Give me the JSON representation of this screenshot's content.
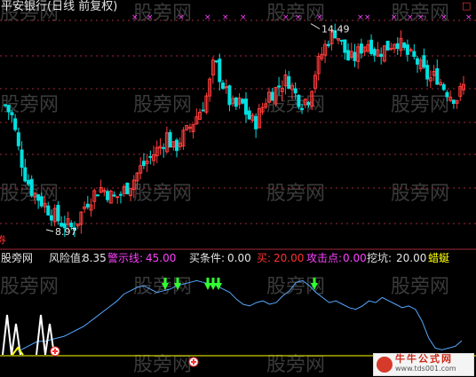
{
  "header": {
    "title": "平安银行(日线 前复权)",
    "corner_marker": "□"
  },
  "watermark": "股旁网",
  "watermark_footer": "股旁网",
  "indicator_bar": {
    "name": "股旁网",
    "items": [
      {
        "label": "风险值:",
        "value": "8.35",
        "color": "#e6e6e6"
      },
      {
        "label": "警示线:",
        "value": "45.00",
        "color": "#ff40ff"
      },
      {
        "label": "买条件:",
        "value": "0.00",
        "color": "#e6e6e6"
      },
      {
        "label": "买:",
        "value": "20.00",
        "color": "#ff3030"
      },
      {
        "label": "攻击点:",
        "value": "0.00",
        "color": "#ff40ff"
      },
      {
        "label": "挖坑:",
        "value": "20.00",
        "color": "#e6e6e6"
      },
      {
        "label": "蜡蜒",
        "value": "",
        "color": "#ffff00"
      }
    ]
  },
  "left_edge_label": "券",
  "logo_site": "www.tds001.com",
  "logo_text": "牛牛公式网",
  "colors": {
    "up": "#ff3c3c",
    "down": "#00e0e0",
    "dotted_grid": "#a0283c",
    "signal_magenta": "#ff40ff",
    "risk_line": "#54a8ff",
    "warn_line": "#ffff00",
    "buy_arrow": "#30ff30",
    "white": "#ffffff"
  },
  "chart_data": [
    {
      "type": "candlestick",
      "annotations": [
        {
          "text": "14.49",
          "kind": "high"
        },
        {
          "text": "8.97",
          "kind": "low"
        }
      ],
      "close_path": [
        12.3,
        12.0,
        11.1,
        10.4,
        10.0,
        9.8,
        9.6,
        9.4,
        9.2,
        9.1,
        9.0,
        9.3,
        9.7,
        9.9,
        10.1,
        10.0,
        9.8,
        9.9,
        10.1,
        10.3,
        10.6,
        10.8,
        11.0,
        11.2,
        11.5,
        11.1,
        11.4,
        11.6,
        11.9,
        12.2,
        12.6,
        13.5,
        13.0,
        12.5,
        12.2,
        12.4,
        12.0,
        11.8,
        12.2,
        12.6,
        12.7,
        12.9,
        13.0,
        12.6,
        12.4,
        12.5,
        13.2,
        13.7,
        14.1,
        14.3,
        13.9,
        13.5,
        13.6,
        13.9,
        14.0,
        13.7,
        13.8,
        13.9,
        14.1,
        13.8,
        13.6,
        13.5,
        13.2,
        13.0,
        13.1,
        12.8,
        12.6,
        12.5,
        12.8
      ],
      "low_label": 8.97,
      "high_label": 14.49
    },
    {
      "type": "line",
      "title": "风险值",
      "series": [
        {
          "name": "风险值",
          "values": [
            2,
            4,
            6,
            8,
            8,
            9,
            10,
            11,
            13,
            15,
            17,
            20,
            23,
            26,
            29,
            32,
            36,
            38,
            40,
            41,
            39,
            37,
            38,
            39,
            41,
            42,
            43,
            44,
            43,
            42,
            41,
            39,
            37,
            33,
            30,
            29,
            31,
            32,
            30,
            31,
            35,
            38,
            43,
            44,
            41,
            37,
            34,
            31,
            32,
            30,
            28,
            27,
            29,
            32,
            31,
            34,
            32,
            30,
            28,
            29,
            27,
            20,
            10,
            4,
            3,
            4,
            5,
            8.35
          ]
        },
        {
          "name": "警示线",
          "values": [
            45
          ]
        }
      ]
    }
  ]
}
